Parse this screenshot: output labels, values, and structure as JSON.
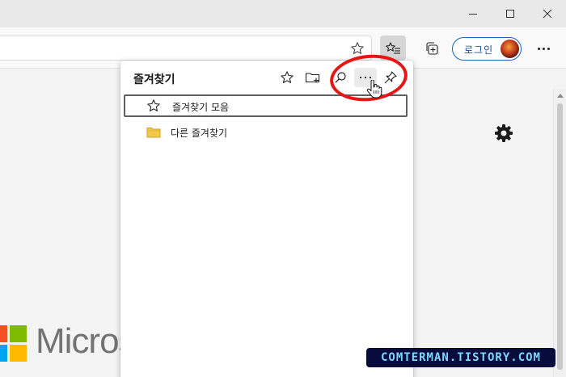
{
  "toolbar": {
    "login_label": "로그인"
  },
  "favorites_panel": {
    "title": "즐겨찾기",
    "items": [
      {
        "label": "즐겨찾기 모음",
        "icon": "star-icon",
        "selected": true
      },
      {
        "label": "다른 즐겨찾기",
        "icon": "folder-icon",
        "selected": false
      }
    ]
  },
  "page": {
    "brand_text": "Micros"
  },
  "watermark": {
    "text": "COMTERMAN.TISTORY.COM"
  },
  "colors": {
    "annotation_ring": "#e81515",
    "login_border": "#1a62b5",
    "folder": "#f2c94c",
    "ms_red": "#f25022",
    "ms_green": "#7fba00",
    "ms_blue": "#00a4ef",
    "ms_yellow": "#ffb900"
  }
}
